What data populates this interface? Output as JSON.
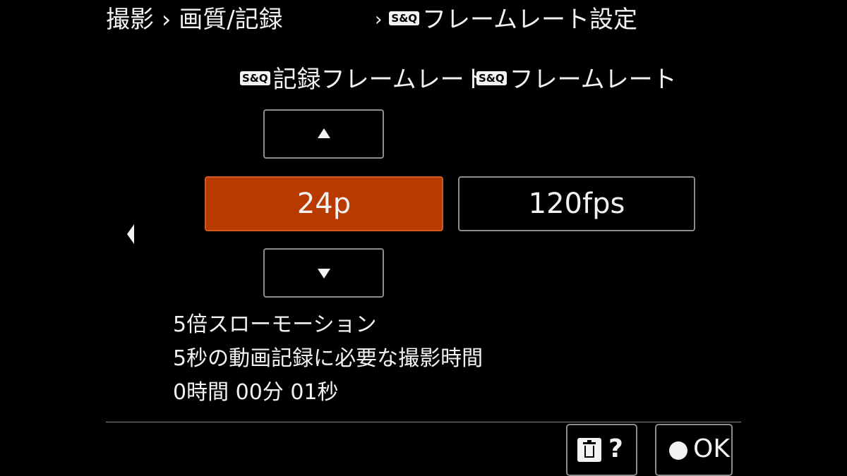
{
  "header": {
    "crumb_left": "撮影 › 画質/記録",
    "separator": "›",
    "badge": "S&Q",
    "crumb_right_title": "フレームレート設定"
  },
  "columns": {
    "left_badge": "S&Q",
    "left_label": "記録フレームレート",
    "right_badge": "S&Q",
    "right_label": "フレームレート"
  },
  "values": {
    "record_frame_rate": "24p",
    "frame_rate": "120fps"
  },
  "info": {
    "line1": "5倍スローモーション",
    "line2": "5秒の動画記録に必要な撮影時間",
    "line3": "0時間 00分 01秒"
  },
  "footer": {
    "help_label": "?",
    "ok_label": "OK"
  },
  "colors": {
    "background": "#000000",
    "selected": "#b83a00",
    "border": "#8c8c8c",
    "text": "#f2f2f2"
  },
  "icons": {
    "up": "triangle-up-icon",
    "down": "triangle-down-icon",
    "left": "triangle-left-icon",
    "delete": "trash-icon",
    "confirm": "circle-button-icon"
  }
}
